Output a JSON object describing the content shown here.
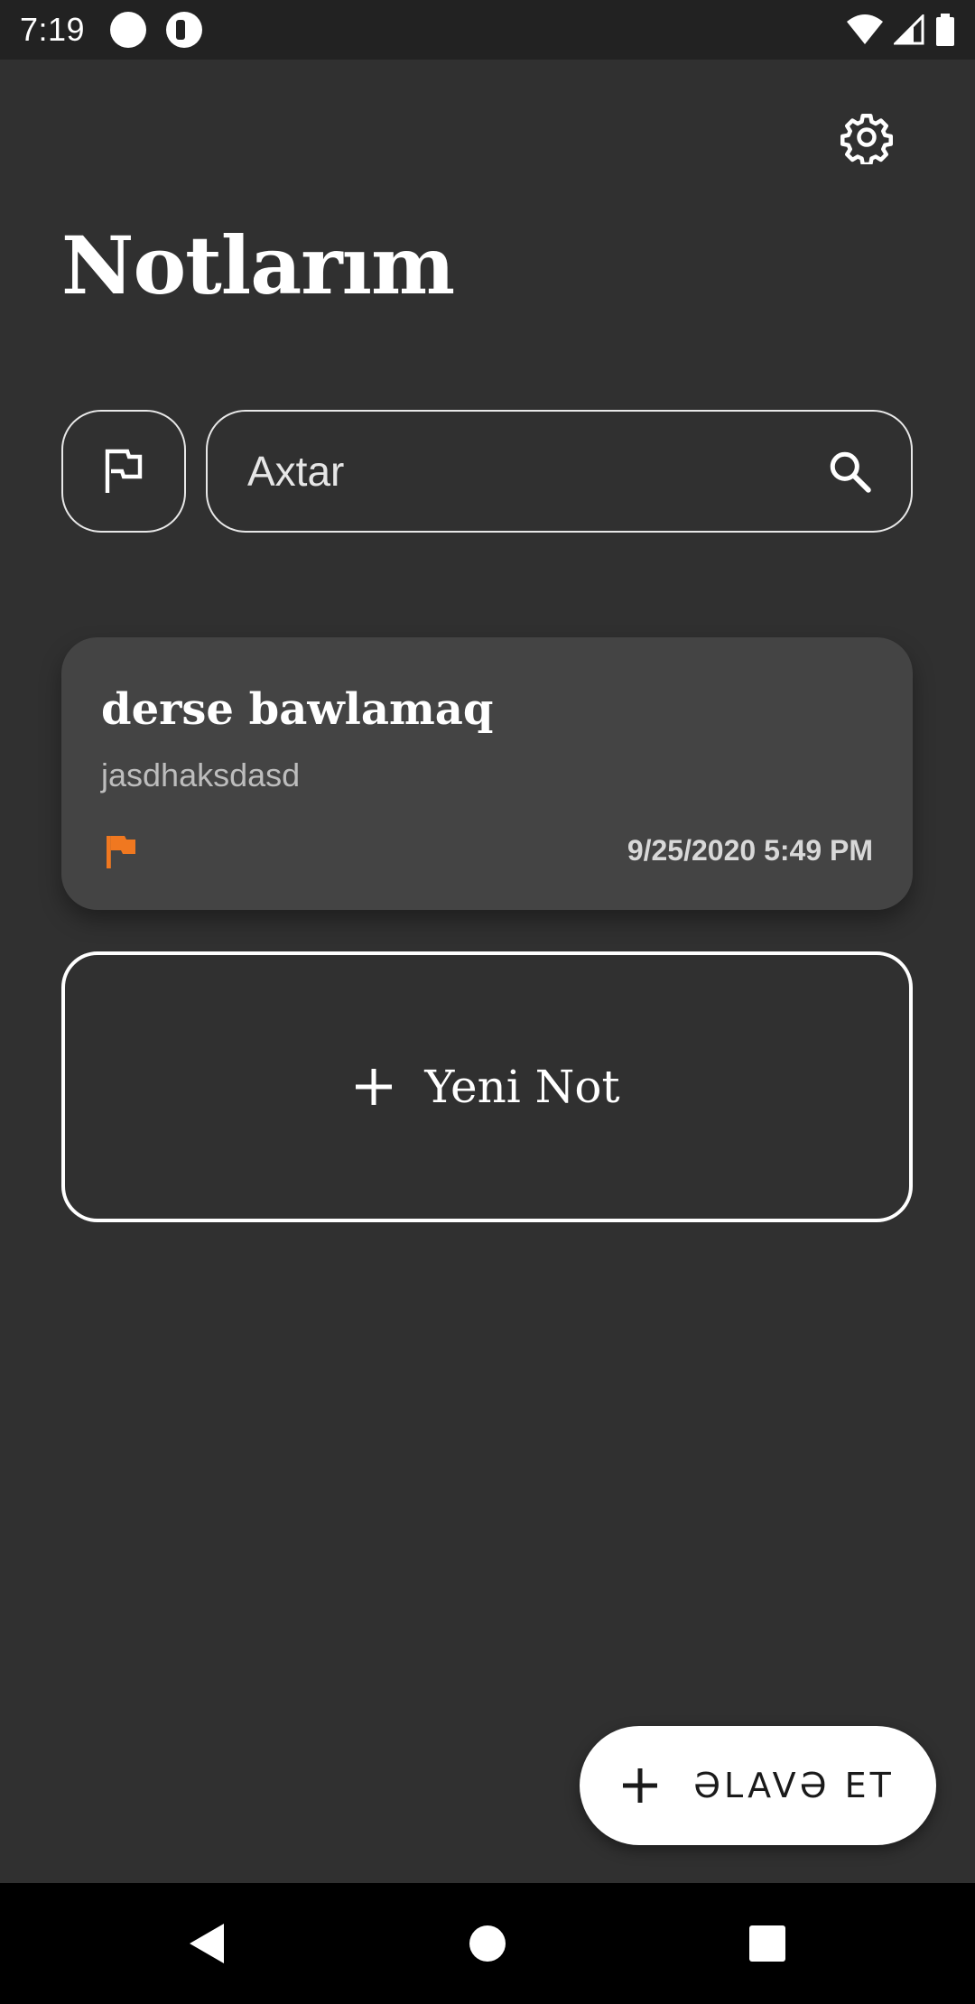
{
  "status_bar": {
    "time": "7:19"
  },
  "header": {
    "title": "Notlarım",
    "settings_icon": "gear-icon"
  },
  "search": {
    "placeholder": "Axtar",
    "value": ""
  },
  "notes": [
    {
      "title": "derse bawlamaq",
      "body": "jasdhaksdasd",
      "date": "9/25/2020 5:49 PM",
      "flag_color": "#f07820"
    }
  ],
  "new_note": {
    "label": "Yeni Not"
  },
  "fab": {
    "label": "ƏLAVƏ ET"
  },
  "colors": {
    "background": "#303030",
    "card": "#444444",
    "flag": "#f07820"
  }
}
